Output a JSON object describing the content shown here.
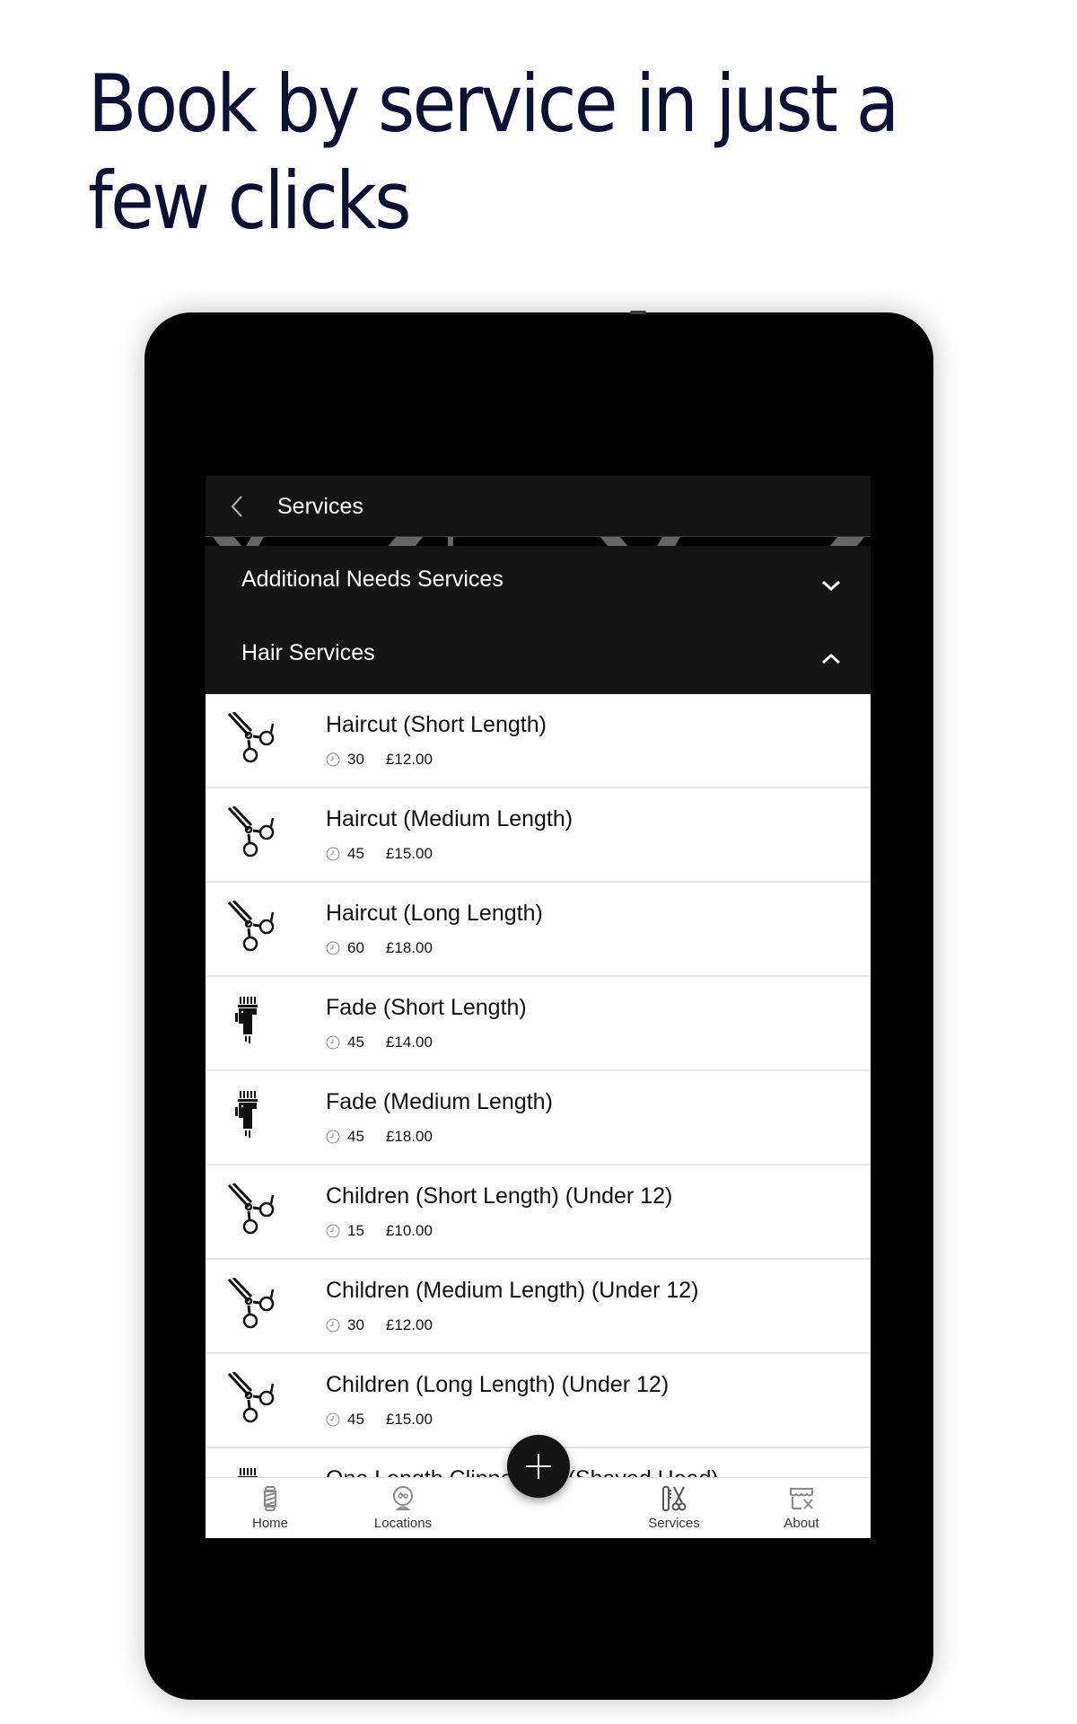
{
  "headline": "Book by service in just a few clicks",
  "appbar": {
    "title": "Services",
    "back_icon": "chevron-left-icon"
  },
  "accordion": [
    {
      "label": "Additional Needs Services",
      "state": "collapsed",
      "icon": "chevron-down-icon"
    },
    {
      "label": "Hair Services",
      "state": "expanded",
      "icon": "chevron-up-icon"
    }
  ],
  "services": [
    {
      "name": "Haircut (Short Length)",
      "duration": "30",
      "price": "£12.00",
      "icon": "scissors-icon"
    },
    {
      "name": "Haircut (Medium Length)",
      "duration": "45",
      "price": "£15.00",
      "icon": "scissors-icon"
    },
    {
      "name": "Haircut (Long Length)",
      "duration": "60",
      "price": "£18.00",
      "icon": "scissors-icon"
    },
    {
      "name": "Fade (Short Length)",
      "duration": "45",
      "price": "£14.00",
      "icon": "clipper-icon"
    },
    {
      "name": "Fade (Medium Length)",
      "duration": "45",
      "price": "£18.00",
      "icon": "clipper-icon"
    },
    {
      "name": "Children (Short Length) (Under 12)",
      "duration": "15",
      "price": "£10.00",
      "icon": "scissors-icon"
    },
    {
      "name": "Children (Medium Length) (Under 12)",
      "duration": "30",
      "price": "£12.00",
      "icon": "scissors-icon"
    },
    {
      "name": "Children (Long Length) (Under 12)",
      "duration": "45",
      "price": "£15.00",
      "icon": "scissors-icon"
    },
    {
      "name": "One Length Clipper Cut (Shaved Head)",
      "duration": "",
      "price": "",
      "icon": "clipper-icon"
    }
  ],
  "tabbar": {
    "items": [
      {
        "label": "Home",
        "icon": "barber-pole-icon"
      },
      {
        "label": "Locations",
        "icon": "location-pin-icon"
      },
      {
        "label": "Services",
        "icon": "comb-scissors-icon"
      },
      {
        "label": "About",
        "icon": "shop-icon"
      }
    ],
    "fab_icon": "plus-icon"
  },
  "colors": {
    "headline": "#0d0f33",
    "appbar_bg": "#141414",
    "accordion_bg": "#151515",
    "frame": "#000000",
    "list_bg": "#ffffff",
    "divider": "#e6e6e6"
  }
}
